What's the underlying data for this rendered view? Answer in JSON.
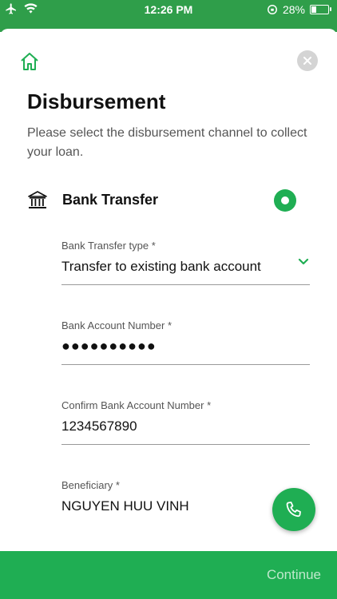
{
  "status_bar": {
    "time": "12:26 PM",
    "battery": "28%",
    "battery_level": 0.28
  },
  "page": {
    "title": "Disbursement",
    "subtitle": "Please select the disbursement channel to collect your loan."
  },
  "channel": {
    "label": "Bank Transfer",
    "selected": true
  },
  "fields": {
    "transfer_type": {
      "label": "Bank Transfer type *",
      "value": "Transfer to existing bank account"
    },
    "account_number": {
      "label": "Bank Account Number *",
      "value": "●●●●●●●●●●"
    },
    "confirm_account": {
      "label": "Confirm Bank Account Number *",
      "value": "1234567890"
    },
    "beneficiary": {
      "label": "Beneficiary *",
      "value": "NGUYEN HUU VINH"
    }
  },
  "actions": {
    "continue_label": "Continue"
  },
  "colors": {
    "primary": "#1fae53",
    "status": "#2f9e4a"
  },
  "icons": [
    "airplane-icon",
    "wifi-icon",
    "rotation-lock-icon",
    "battery-icon",
    "home-icon",
    "close-icon",
    "bank-icon",
    "chevron-down-icon",
    "phone-icon"
  ]
}
